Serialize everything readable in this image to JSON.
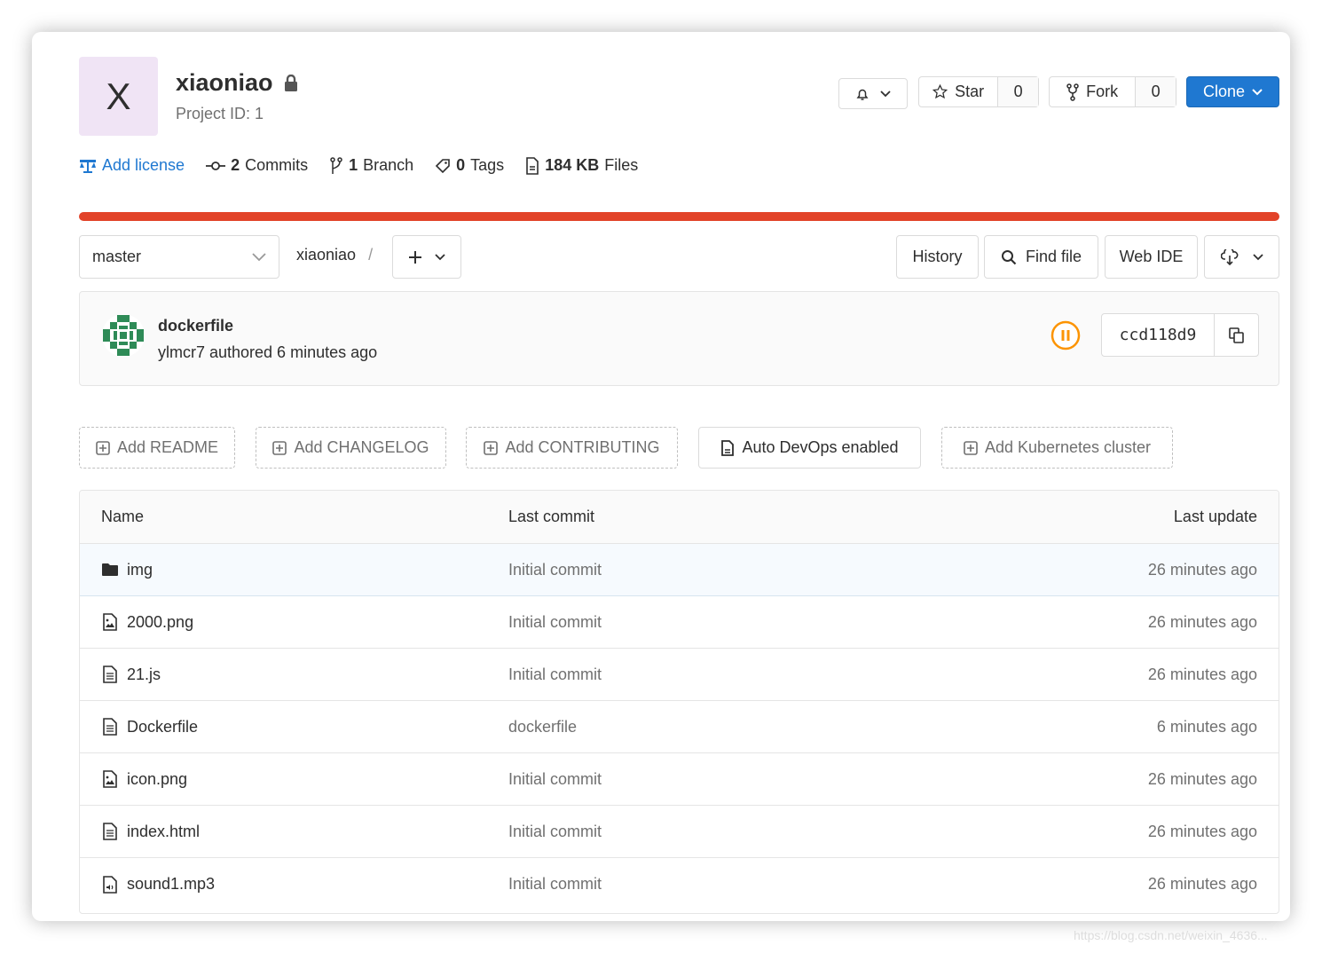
{
  "project": {
    "avatar_letter": "X",
    "name": "xiaoniao",
    "id_label": "Project ID: 1"
  },
  "actions": {
    "star_label": "Star",
    "star_count": "0",
    "fork_label": "Fork",
    "fork_count": "0",
    "clone_label": "Clone"
  },
  "stats": {
    "license": "Add license",
    "commits_count": "2",
    "commits_label": "Commits",
    "branch_count": "1",
    "branch_label": "Branch",
    "tags_count": "0",
    "tags_label": "Tags",
    "files_size": "184 KB",
    "files_label": "Files"
  },
  "toolbar": {
    "branch": "master",
    "path": "xiaoniao",
    "path_sep": "/",
    "history": "History",
    "find_file": "Find file",
    "web_ide": "Web IDE"
  },
  "last_commit": {
    "title": "dockerfile",
    "meta": "ylmcr7 authored 6 minutes ago",
    "sha": "ccd118d9"
  },
  "add_buttons": {
    "readme": "Add README",
    "changelog": "Add CHANGELOG",
    "contributing": "Add CONTRIBUTING",
    "devops": "Auto DevOps enabled",
    "kubernetes": "Add Kubernetes cluster"
  },
  "tree": {
    "headers": {
      "name": "Name",
      "commit": "Last commit",
      "update": "Last update"
    },
    "rows": [
      {
        "name": "img",
        "icon": "folder-icon",
        "commit": "Initial commit",
        "update": "26 minutes ago"
      },
      {
        "name": "2000.png",
        "icon": "image-file-icon",
        "commit": "Initial commit",
        "update": "26 minutes ago"
      },
      {
        "name": "21.js",
        "icon": "text-file-icon",
        "commit": "Initial commit",
        "update": "26 minutes ago"
      },
      {
        "name": "Dockerfile",
        "icon": "text-file-icon",
        "commit": "dockerfile",
        "update": "6 minutes ago"
      },
      {
        "name": "icon.png",
        "icon": "image-file-icon",
        "commit": "Initial commit",
        "update": "26 minutes ago"
      },
      {
        "name": "index.html",
        "icon": "text-file-icon",
        "commit": "Initial commit",
        "update": "26 minutes ago"
      },
      {
        "name": "sound1.mp3",
        "icon": "audio-file-icon",
        "commit": "Initial commit",
        "update": "26 minutes ago"
      }
    ]
  },
  "colors": {
    "accent": "#1f78d1",
    "progress": "#e24329",
    "pipeline": "#fc9403"
  },
  "watermark": "https://blog.csdn.net/weixin_4636..."
}
